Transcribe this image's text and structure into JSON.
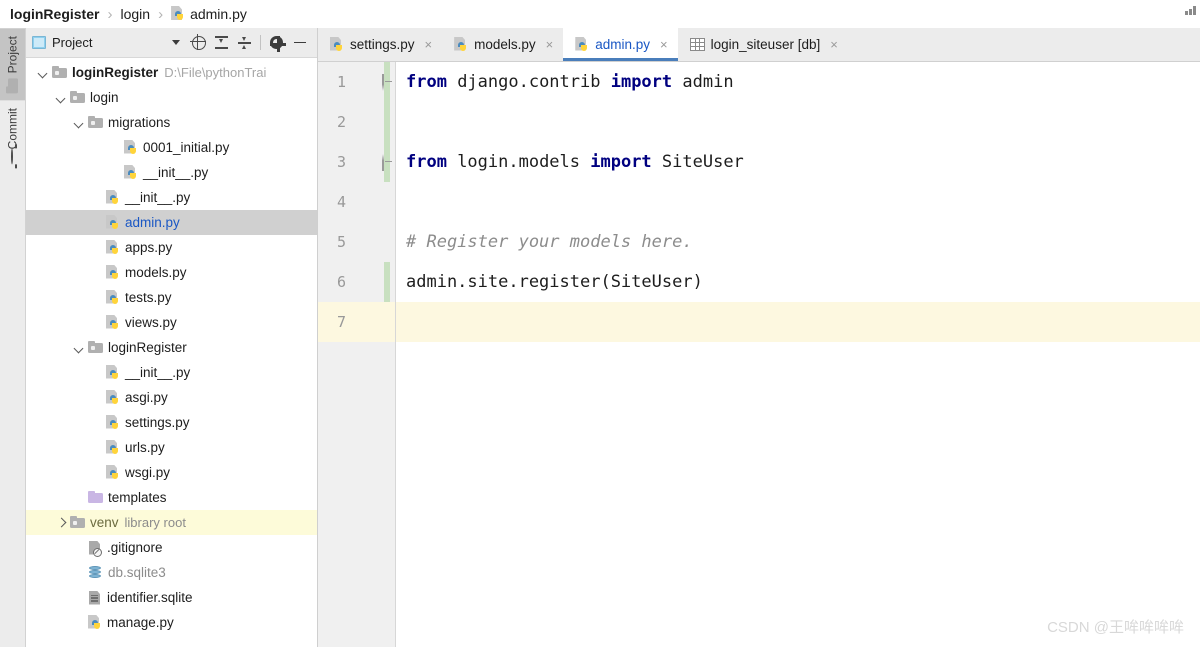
{
  "breadcrumb": {
    "items": [
      {
        "label": "loginRegister",
        "bold": true,
        "icon": null
      },
      {
        "label": "login",
        "bold": false,
        "icon": null
      },
      {
        "label": "admin.py",
        "bold": false,
        "icon": "python-file-icon"
      }
    ],
    "separator": "›"
  },
  "rail": {
    "tabs": [
      {
        "label": "Project",
        "icon": "folder-icon",
        "selected": true
      },
      {
        "label": "Commit",
        "icon": "commit-icon",
        "selected": false
      }
    ]
  },
  "project_panel": {
    "toolbar": {
      "title": "Project",
      "window_icon": "project-window-icon",
      "buttons": [
        {
          "name": "chevron-down-icon",
          "label": ""
        },
        {
          "name": "select-opened-file-icon",
          "label": ""
        },
        {
          "name": "expand-all-icon",
          "label": ""
        },
        {
          "name": "collapse-all-icon",
          "label": ""
        },
        {
          "name": "gear-icon",
          "label": ""
        },
        {
          "name": "hide-panel-icon",
          "label": ""
        }
      ]
    },
    "tree": [
      {
        "label": "loginRegister",
        "sub": "D:\\File\\pythonTrai",
        "indent": 0,
        "arrow": "down",
        "icon": "folder",
        "bold": true,
        "state": "normal"
      },
      {
        "label": "login",
        "sub": "",
        "indent": 1,
        "arrow": "down",
        "icon": "folder",
        "bold": false,
        "state": "normal"
      },
      {
        "label": "migrations",
        "sub": "",
        "indent": 2,
        "arrow": "down",
        "icon": "folder",
        "bold": false,
        "state": "normal"
      },
      {
        "label": "0001_initial.py",
        "sub": "",
        "indent": 4,
        "arrow": "none",
        "icon": "python",
        "bold": false,
        "state": "normal"
      },
      {
        "label": "__init__.py",
        "sub": "",
        "indent": 4,
        "arrow": "none",
        "icon": "python",
        "bold": false,
        "state": "normal"
      },
      {
        "label": "__init__.py",
        "sub": "",
        "indent": 3,
        "arrow": "none",
        "icon": "python",
        "bold": false,
        "state": "normal"
      },
      {
        "label": "admin.py",
        "sub": "",
        "indent": 3,
        "arrow": "none",
        "icon": "python",
        "bold": false,
        "state": "selected"
      },
      {
        "label": "apps.py",
        "sub": "",
        "indent": 3,
        "arrow": "none",
        "icon": "python",
        "bold": false,
        "state": "normal"
      },
      {
        "label": "models.py",
        "sub": "",
        "indent": 3,
        "arrow": "none",
        "icon": "python",
        "bold": false,
        "state": "normal"
      },
      {
        "label": "tests.py",
        "sub": "",
        "indent": 3,
        "arrow": "none",
        "icon": "python",
        "bold": false,
        "state": "normal"
      },
      {
        "label": "views.py",
        "sub": "",
        "indent": 3,
        "arrow": "none",
        "icon": "python",
        "bold": false,
        "state": "normal"
      },
      {
        "label": "loginRegister",
        "sub": "",
        "indent": 2,
        "arrow": "down",
        "icon": "folder",
        "bold": false,
        "state": "normal"
      },
      {
        "label": "__init__.py",
        "sub": "",
        "indent": 3,
        "arrow": "none",
        "icon": "python",
        "bold": false,
        "state": "normal"
      },
      {
        "label": "asgi.py",
        "sub": "",
        "indent": 3,
        "arrow": "none",
        "icon": "python",
        "bold": false,
        "state": "normal"
      },
      {
        "label": "settings.py",
        "sub": "",
        "indent": 3,
        "arrow": "none",
        "icon": "python",
        "bold": false,
        "state": "normal"
      },
      {
        "label": "urls.py",
        "sub": "",
        "indent": 3,
        "arrow": "none",
        "icon": "python",
        "bold": false,
        "state": "normal"
      },
      {
        "label": "wsgi.py",
        "sub": "",
        "indent": 3,
        "arrow": "none",
        "icon": "python",
        "bold": false,
        "state": "normal"
      },
      {
        "label": "templates",
        "sub": "",
        "indent": 2,
        "arrow": "none",
        "icon": "folder-purple",
        "bold": false,
        "state": "normal"
      },
      {
        "label": "venv",
        "sub": "library root",
        "indent": 1,
        "arrow": "right",
        "icon": "folder",
        "bold": false,
        "state": "highlight"
      },
      {
        "label": ".gitignore",
        "sub": "",
        "indent": 2,
        "arrow": "none",
        "icon": "ignored-file",
        "bold": false,
        "state": "normal"
      },
      {
        "label": "db.sqlite3",
        "sub": "",
        "indent": 2,
        "arrow": "none",
        "icon": "db",
        "bold": false,
        "state": "greyed"
      },
      {
        "label": "identifier.sqlite",
        "sub": "",
        "indent": 2,
        "arrow": "none",
        "icon": "text-file",
        "bold": false,
        "state": "normal"
      },
      {
        "label": "manage.py",
        "sub": "",
        "indent": 2,
        "arrow": "none",
        "icon": "python",
        "bold": false,
        "state": "normal"
      }
    ]
  },
  "editor": {
    "tabs": [
      {
        "label": "settings.py",
        "icon": "python-file-icon",
        "active": false,
        "close": "×"
      },
      {
        "label": "models.py",
        "icon": "python-file-icon",
        "active": false,
        "close": "×"
      },
      {
        "label": "admin.py",
        "icon": "python-file-icon",
        "active": true,
        "close": "×"
      },
      {
        "label": "login_siteuser [db]",
        "icon": "table-grid-icon",
        "active": false,
        "close": "×"
      }
    ],
    "lines": [
      {
        "number": "1",
        "caret": false,
        "fold": "open",
        "change": true,
        "tokens": [
          {
            "t": "from",
            "c": "kw"
          },
          {
            "t": " django.contrib ",
            "c": ""
          },
          {
            "t": "import",
            "c": "kw"
          },
          {
            "t": " admin",
            "c": ""
          }
        ]
      },
      {
        "number": "2",
        "caret": false,
        "fold": "none",
        "change": true,
        "tokens": []
      },
      {
        "number": "3",
        "caret": false,
        "fold": "close",
        "change": true,
        "tokens": [
          {
            "t": "from",
            "c": "kw"
          },
          {
            "t": " login.models ",
            "c": ""
          },
          {
            "t": "import",
            "c": "kw"
          },
          {
            "t": " SiteUser",
            "c": ""
          }
        ]
      },
      {
        "number": "4",
        "caret": false,
        "fold": "none",
        "change": false,
        "tokens": []
      },
      {
        "number": "5",
        "caret": false,
        "fold": "none",
        "change": false,
        "tokens": [
          {
            "t": "# Register your models here.",
            "c": "cmt"
          }
        ]
      },
      {
        "number": "6",
        "caret": false,
        "fold": "none",
        "change": true,
        "tokens": [
          {
            "t": "admin.site.register(SiteUser)",
            "c": ""
          }
        ]
      },
      {
        "number": "7",
        "caret": true,
        "fold": "none",
        "change": false,
        "tokens": []
      }
    ]
  },
  "watermark": "CSDN @王哞哞哞哞",
  "colors": {
    "accent_blue": "#1a57c4",
    "tab_underline": "#4a7ebb",
    "keyword": "#000080",
    "comment": "#8c8c8c",
    "caret_line": "#fdf8e0",
    "selection_grey": "#d0d0d0",
    "change_stripe_green": "#c8e0c0",
    "toolbar_grey": "#ececec"
  }
}
